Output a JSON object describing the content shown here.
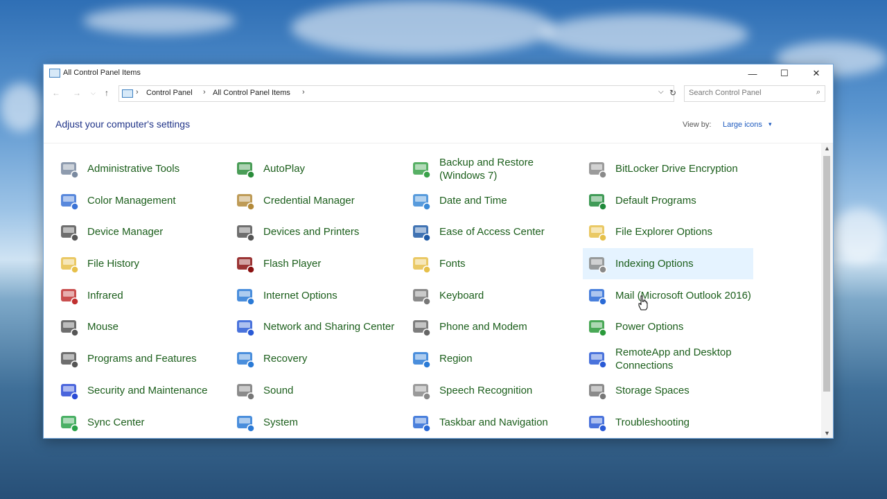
{
  "window": {
    "title": "All Control Panel Items"
  },
  "titlebar_controls": {
    "minimize": "—",
    "maximize": "☐",
    "close": "✕"
  },
  "nav": {
    "back": "←",
    "forward": "→",
    "dropdown": "⌵",
    "up": "↑",
    "refresh": "↻"
  },
  "breadcrumbs": [
    "Control Panel",
    "All Control Panel Items"
  ],
  "breadcrumb_sep": "›",
  "search": {
    "placeholder": "Search Control Panel",
    "icon": "⌕"
  },
  "heading": "Adjust your computer's settings",
  "view_by": {
    "label": "View by:",
    "value": "Large icons",
    "caret": "▾"
  },
  "scroll": {
    "up": "▲",
    "down": "▼"
  },
  "items": [
    {
      "label": "Administrative Tools",
      "icon": "tools-icon",
      "color": "#7a8aa0"
    },
    {
      "label": "AutoPlay",
      "icon": "autoplay-icon",
      "color": "#2a8c3a"
    },
    {
      "label": "Backup and Restore (Windows 7)",
      "icon": "backup-icon",
      "color": "#3aa24a"
    },
    {
      "label": "BitLocker Drive Encryption",
      "icon": "key-icon",
      "color": "#8a8a8a"
    },
    {
      "label": "Color Management",
      "icon": "color-icon",
      "color": "#3b73d6"
    },
    {
      "label": "Credential Manager",
      "icon": "credential-icon",
      "color": "#b38a3a"
    },
    {
      "label": "Date and Time",
      "icon": "calendar-icon",
      "color": "#3b8ad6"
    },
    {
      "label": "Default Programs",
      "icon": "default-programs-icon",
      "color": "#1f8a3a"
    },
    {
      "label": "Device Manager",
      "icon": "device-manager-icon",
      "color": "#555555"
    },
    {
      "label": "Devices and Printers",
      "icon": "printer-icon",
      "color": "#555555"
    },
    {
      "label": "Ease of Access Center",
      "icon": "accessibility-icon",
      "color": "#1f5aa6"
    },
    {
      "label": "File Explorer Options",
      "icon": "folder-options-icon",
      "color": "#e6c04a"
    },
    {
      "label": "File History",
      "icon": "file-history-icon",
      "color": "#e6c04a"
    },
    {
      "label": "Flash Player",
      "icon": "flash-icon",
      "color": "#8a1010"
    },
    {
      "label": "Fonts",
      "icon": "fonts-icon",
      "color": "#e6c04a"
    },
    {
      "label": "Indexing Options",
      "icon": "indexing-icon",
      "color": "#8a8a8a"
    },
    {
      "label": "Infrared",
      "icon": "infrared-icon",
      "color": "#c03030"
    },
    {
      "label": "Internet Options",
      "icon": "internet-icon",
      "color": "#2a7ad6"
    },
    {
      "label": "Keyboard",
      "icon": "keyboard-icon",
      "color": "#777777"
    },
    {
      "label": "Mail (Microsoft Outlook 2016)",
      "icon": "mail-icon",
      "color": "#2a6ad6"
    },
    {
      "label": "Mouse",
      "icon": "mouse-icon",
      "color": "#555555"
    },
    {
      "label": "Network and Sharing Center",
      "icon": "network-icon",
      "color": "#2a5ad6"
    },
    {
      "label": "Phone and Modem",
      "icon": "phone-icon",
      "color": "#666666"
    },
    {
      "label": "Power Options",
      "icon": "power-icon",
      "color": "#2a9a3a"
    },
    {
      "label": "Programs and Features",
      "icon": "programs-icon",
      "color": "#555555"
    },
    {
      "label": "Recovery",
      "icon": "recovery-icon",
      "color": "#2a7ad6"
    },
    {
      "label": "Region",
      "icon": "region-icon",
      "color": "#2a7ad6"
    },
    {
      "label": "RemoteApp and Desktop Connections",
      "icon": "remoteapp-icon",
      "color": "#2a5ad6"
    },
    {
      "label": "Security and Maintenance",
      "icon": "flag-icon",
      "color": "#2a4ad6"
    },
    {
      "label": "Sound",
      "icon": "sound-icon",
      "color": "#777777"
    },
    {
      "label": "Speech Recognition",
      "icon": "microphone-icon",
      "color": "#888888"
    },
    {
      "label": "Storage Spaces",
      "icon": "storage-icon",
      "color": "#777777"
    },
    {
      "label": "Sync Center",
      "icon": "sync-icon",
      "color": "#2aa24a"
    },
    {
      "label": "System",
      "icon": "system-icon",
      "color": "#2a7ad6"
    },
    {
      "label": "Taskbar and Navigation",
      "icon": "taskbar-icon",
      "color": "#2a6ad6"
    },
    {
      "label": "Troubleshooting",
      "icon": "troubleshooting-icon",
      "color": "#2a5ad6"
    }
  ],
  "highlighted_item": "Indexing Options",
  "accent_color": "#1b5e1b"
}
